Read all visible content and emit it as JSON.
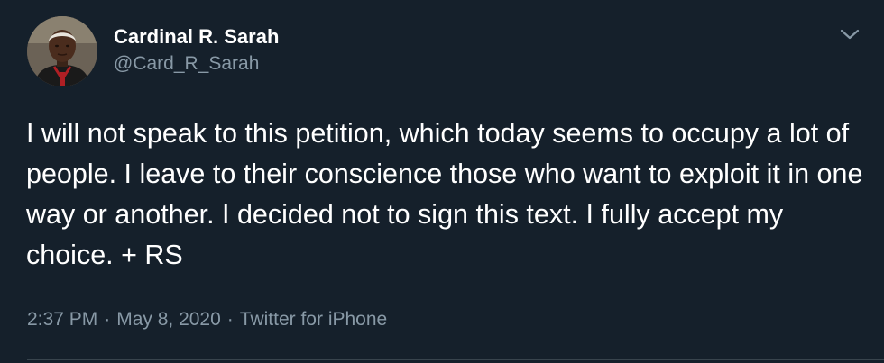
{
  "tweet": {
    "author": {
      "display_name": "Cardinal R. Sarah",
      "handle": "@Card_R_Sarah"
    },
    "text": "I will not speak to this petition, which today seems to occupy a lot of people. I leave to their conscience those who want to exploit it in one way or another. I decided not to sign this text. I fully accept my choice. + RS",
    "time": "2:37 PM",
    "separator": "·",
    "date": "May 8, 2020",
    "source": "Twitter for iPhone"
  },
  "icons": {
    "menu": "chevron-down-icon"
  },
  "colors": {
    "background": "#15202b",
    "primary_text": "#ffffff",
    "secondary_text": "#8899a6",
    "divider": "#38444d"
  }
}
